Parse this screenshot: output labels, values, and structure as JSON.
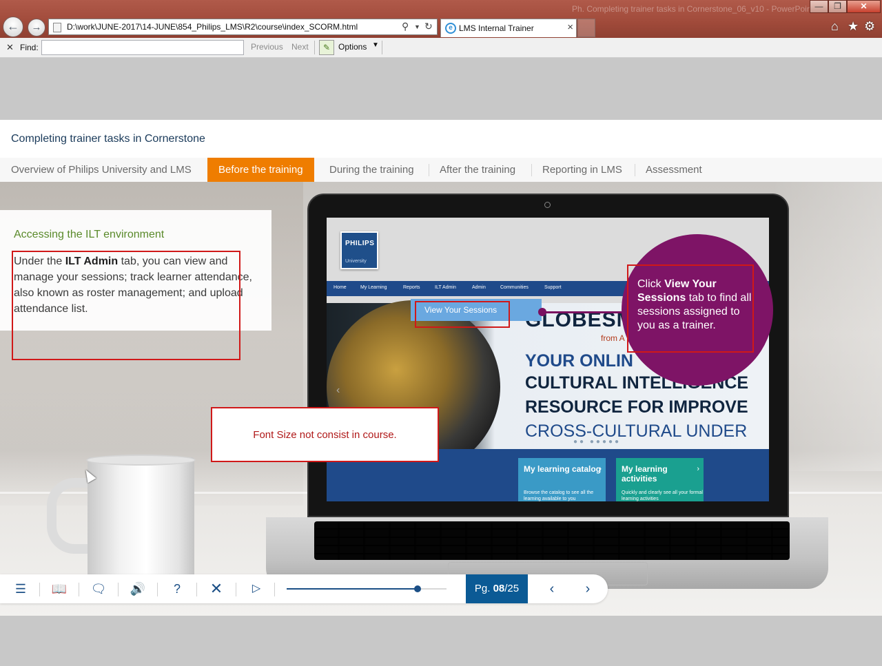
{
  "browser": {
    "window_title": "Ph. Completing trainer tasks in Cornerstone_06_v10 - PowerPoint",
    "address": "D:\\work\\JUNE-2017\\14-JUNE\\854_Philips_LMS\\R2\\course\\index_SCORM.html",
    "tab_title": "LMS Internal Trainer",
    "icons": [
      "back-icon",
      "forward-icon",
      "search-icon",
      "refresh-icon",
      "home-icon",
      "favorites-icon",
      "settings-icon"
    ]
  },
  "findbar": {
    "label": "Find:",
    "value": "",
    "previous": "Previous",
    "next": "Next",
    "options": "Options"
  },
  "course": {
    "title": "Completing trainer tasks in Cornerstone",
    "tabs": [
      {
        "label": "Overview of Philips University and LMS",
        "active": false
      },
      {
        "label": "Before the training",
        "active": true
      },
      {
        "label": "During the training",
        "active": false
      },
      {
        "label": "After the training",
        "active": false
      },
      {
        "label": "Reporting in LMS",
        "active": false
      },
      {
        "label": "Assessment",
        "active": false
      }
    ],
    "accent_color": "#ef7d00"
  },
  "slide": {
    "heading": "Accessing the ILT environment",
    "body_pre": "Under the ",
    "body_bold": "ILT Admin",
    "body_post": " tab, you can view and manage your sessions; track learner attendance, also known as roster management; and upload attendance list.",
    "callout_pre": "Click ",
    "callout_bold": "View Your Sessions",
    "callout_post": " tab to find all sessions assigned to you as a trainer.",
    "comment": "Font Size not consist in course."
  },
  "lms_screen": {
    "logo": "PHILIPS",
    "logo_sub": "University",
    "menu": [
      "Home",
      "My Learning",
      "Reports",
      "ILT Admin",
      "Admin",
      "Communities",
      "Support"
    ],
    "submenu_item": "View Your Sessions",
    "hero_brand": "GLOBESM",
    "hero_brand_sub": "from A",
    "hero_lines": [
      "YOUR ONLIN",
      "CULTURAL INTELLIGENCE",
      "RESOURCE FOR IMPROVE",
      "CROSS-CULTURAL UNDER"
    ],
    "carousel_dots": "●● ●●●●●",
    "cards": [
      {
        "title": "My learning catalog",
        "desc": "Browse the catalog to see all the learning available to you"
      },
      {
        "title": "My learning activities",
        "desc": "Quickly and clearly see all your formal learning activities"
      }
    ]
  },
  "player": {
    "page_prefix": "Pg. ",
    "page_current": "08",
    "page_total": "/25",
    "progress": 0.82,
    "buttons": [
      "menu-icon",
      "glossary-icon",
      "comment-icon",
      "audio-icon",
      "help-icon",
      "exit-icon",
      "play-icon"
    ]
  }
}
